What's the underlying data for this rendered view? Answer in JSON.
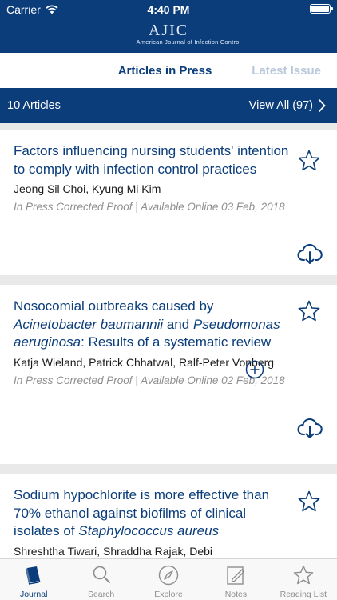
{
  "status_bar": {
    "carrier": "Carrier",
    "time": "4:40 PM"
  },
  "header": {
    "logo_mark": "AJIC",
    "logo_subtitle": "American Journal of Infection Control"
  },
  "tabs": {
    "active": "Articles in Press",
    "inactive": "Latest Issue"
  },
  "count_bar": {
    "count_label": "10 Articles",
    "view_all": "View All (97)"
  },
  "articles": [
    {
      "title": "Factors influencing nursing students' intention to comply with infection control practices",
      "authors": "Jeong Sil Choi, Kyung Mi Kim",
      "meta": "In Press Corrected Proof | Available Online 03 Feb, 2018"
    },
    {
      "title_parts": [
        "Nosocomial outbreaks caused by ",
        "Acinetobacter baumannii",
        " and ",
        "Pseudomonas aeruginosa",
        ": Results of a systematic review"
      ],
      "authors": "Katja Wieland, Patrick Chhatwal, Ralf-Peter Vonberg",
      "meta": "In Press Corrected Proof | Available Online 02 Feb, 2018"
    },
    {
      "title_parts": [
        "Sodium hypochlorite is more effective than 70% ethanol against biofilms of clinical isolates of ",
        "Staphylococcus aureus"
      ],
      "authors": "Shreshtha Tiwari, Shraddha Rajak, Debi"
    }
  ],
  "tabbar": [
    {
      "label": "Journal",
      "icon": "journal-icon",
      "active": true
    },
    {
      "label": "Search",
      "icon": "search-icon"
    },
    {
      "label": "Explore",
      "icon": "compass-icon"
    },
    {
      "label": "Notes",
      "icon": "notes-icon"
    },
    {
      "label": "Reading List",
      "icon": "star-icon"
    }
  ],
  "colors": {
    "brand": "#0a3d7a",
    "inactive_tab": "#b9c8da",
    "meta_gray": "#8e8e8e",
    "separator": "#e9e9ea"
  }
}
